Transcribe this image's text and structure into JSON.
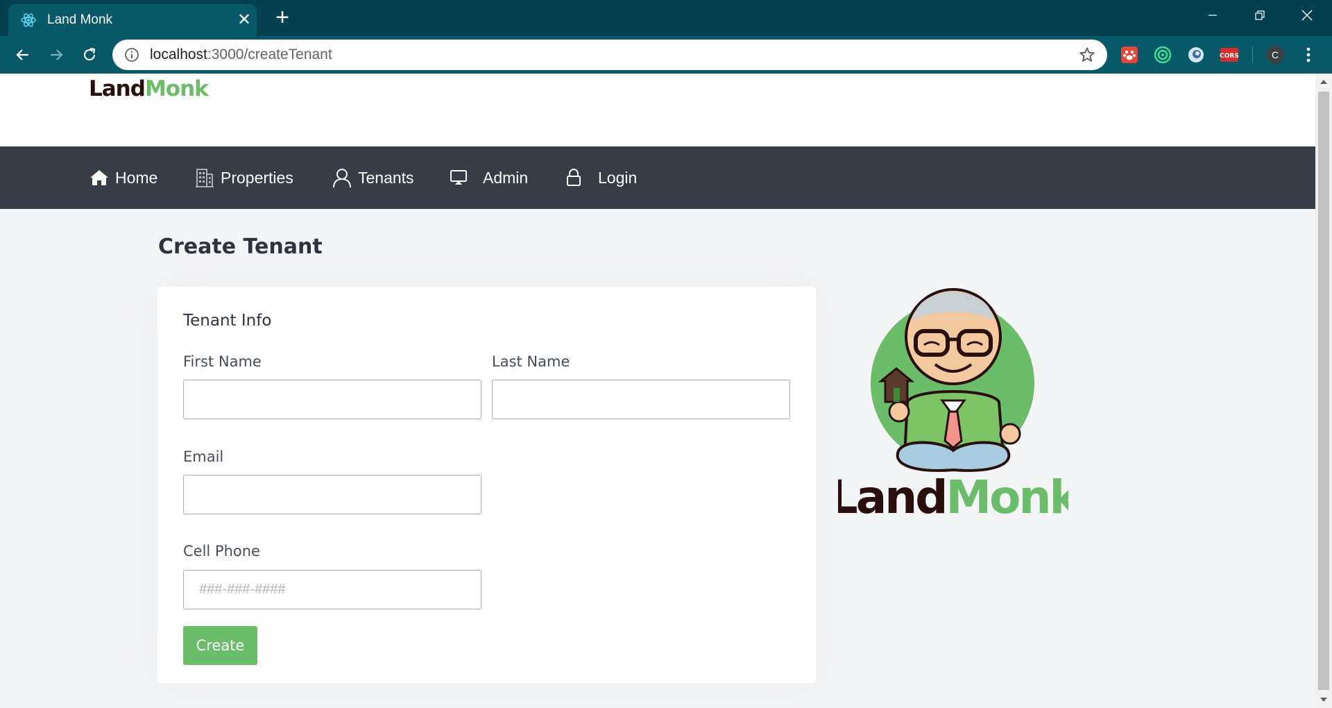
{
  "browser": {
    "tab_title": "Land Monk",
    "url_host": "localhost",
    "url_path": ":3000/createTenant",
    "icons": [
      "react-favicon-icon",
      "close-icon",
      "plus-icon",
      "minimize-icon",
      "restore-icon",
      "close-window-icon",
      "back-icon",
      "forward-icon",
      "reload-icon",
      "info-icon",
      "star-icon",
      "kebab-menu-icon"
    ],
    "extensions": [
      "paw-extension-icon",
      "target-extension-icon",
      "circle-extension-icon",
      "cors-extension-icon"
    ],
    "cors_label": "CORS",
    "profile_initial": "C",
    "theme_color": "#04404f",
    "toolbar_color": "#07596a"
  },
  "site": {
    "logo_land": "Land",
    "logo_monk": "Monk",
    "brand_dark": "#2a0f0f",
    "brand_green": "#6cbd6a",
    "nav": [
      {
        "label": "Home",
        "icon": "home-icon"
      },
      {
        "label": "Properties",
        "icon": "building-icon"
      },
      {
        "label": "Tenants",
        "icon": "user-icon"
      },
      {
        "label": "Admin",
        "icon": "monitor-icon"
      },
      {
        "label": "Login",
        "icon": "lock-icon"
      }
    ],
    "nav_color": "#373d47"
  },
  "main": {
    "page_title": "Create Tenant",
    "card_title": "Tenant Info",
    "fields": {
      "first_name": {
        "label": "First Name",
        "value": "",
        "placeholder": ""
      },
      "last_name": {
        "label": "Last Name",
        "value": "",
        "placeholder": ""
      },
      "email": {
        "label": "Email",
        "value": "",
        "placeholder": ""
      },
      "cell_phone": {
        "label": "Cell Phone",
        "value": "",
        "placeholder": "###-###-####"
      }
    },
    "submit_label": "Create",
    "mascot": {
      "text_land": "Land",
      "text_monk": "Monk"
    }
  }
}
